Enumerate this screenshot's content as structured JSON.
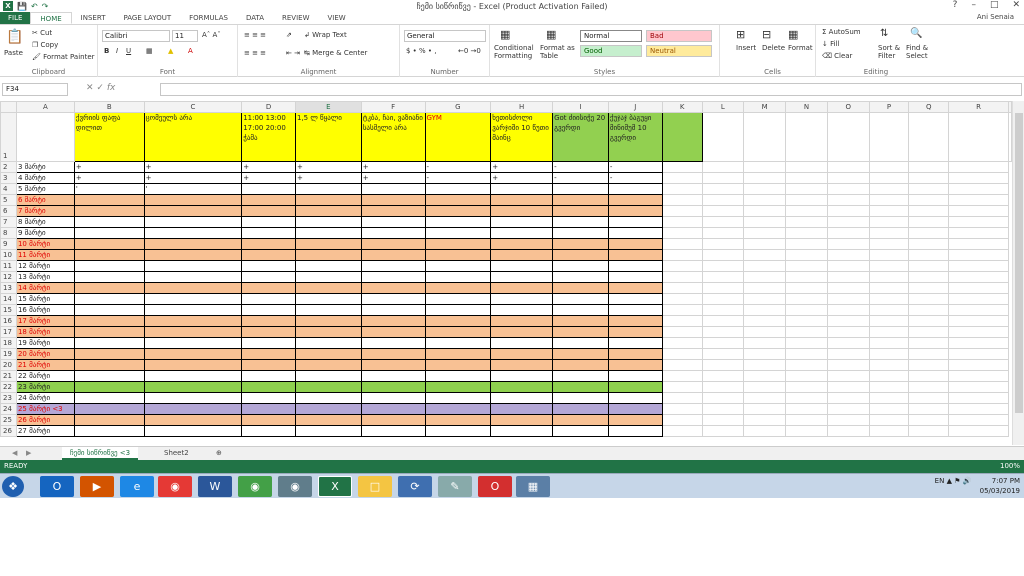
{
  "window": {
    "title": "ჩემი სიწრიწვე - Excel (Product Activation Failed)",
    "user": "Ani Senaia"
  },
  "tabs": [
    "FILE",
    "HOME",
    "INSERT",
    "PAGE LAYOUT",
    "FORMULAS",
    "DATA",
    "REVIEW",
    "VIEW"
  ],
  "ribbon": {
    "clipboard": {
      "paste": "Paste",
      "cut": "Cut",
      "copy": "Copy",
      "format_painter": "Format Painter",
      "label": "Clipboard"
    },
    "font": {
      "name": "Calibri",
      "size": "11",
      "label": "Font"
    },
    "alignment": {
      "wrap": "Wrap Text",
      "merge": "Merge & Center",
      "label": "Alignment"
    },
    "number": {
      "format": "General",
      "label": "Number"
    },
    "styles": {
      "conditional": "Conditional Formatting",
      "format_table": "Format as Table",
      "normal": "Normal",
      "bad": "Bad",
      "good": "Good",
      "neutral": "Neutral",
      "label": "Styles"
    },
    "cells": {
      "insert": "Insert",
      "delete": "Delete",
      "format": "Format",
      "label": "Cells"
    },
    "editing": {
      "autosum": "AutoSum",
      "fill": "Fill",
      "clear": "Clear",
      "sort": "Sort & Filter",
      "find": "Find & Select",
      "label": "Editing"
    }
  },
  "formula_bar": {
    "name_box": "F34",
    "formula": ""
  },
  "columns": [
    "A",
    "B",
    "C",
    "D",
    "E",
    "F",
    "G",
    "H",
    "I",
    "J",
    "K",
    "L",
    "M",
    "N",
    "O",
    "P",
    "Q",
    "R"
  ],
  "header_row": {
    "row_num": "1",
    "cells": [
      "",
      "ქვრიის ფაფა დილით",
      "ცომეულს არა",
      "11:00 13:00 17:00 20:00 ჭამა",
      "1,5 ლ წყალი",
      "ტკბა, ჩაი, ვაზიანი სასმელი არა",
      "GYM",
      "ხეთისძოლი ვარჯიში 10 წუთი მაინც",
      "Got ძიისიჭე 20 გვერდი",
      "ქუჯაჯ ბაგუყი მინიმუმ 10 გვერდი",
      ""
    ]
  },
  "rows": [
    {
      "n": "2",
      "a": "3 მარტი",
      "fill": "",
      "red": false,
      "marks": [
        "+",
        "+",
        "+",
        "+",
        "+",
        "-",
        "+",
        "-",
        "-"
      ]
    },
    {
      "n": "3",
      "a": "4 მარტი",
      "fill": "",
      "red": false,
      "marks": [
        "+",
        "+",
        "+",
        "+",
        "+",
        "-",
        "+",
        "-",
        "-"
      ]
    },
    {
      "n": "4",
      "a": "5 მარტი",
      "fill": "",
      "red": false,
      "marks": [
        "'",
        "'",
        "",
        "",
        "",
        "",
        "",
        "",
        ""
      ]
    },
    {
      "n": "5",
      "a": "6 მარტი",
      "fill": "o",
      "red": true,
      "marks": []
    },
    {
      "n": "6",
      "a": "7 მარტი",
      "fill": "o",
      "red": true,
      "marks": []
    },
    {
      "n": "7",
      "a": "8 მარტი",
      "fill": "",
      "red": false,
      "marks": []
    },
    {
      "n": "8",
      "a": "9 მარტი",
      "fill": "",
      "red": false,
      "marks": []
    },
    {
      "n": "9",
      "a": "10 მარტი",
      "fill": "o",
      "red": true,
      "marks": []
    },
    {
      "n": "10",
      "a": "11 მარტი",
      "fill": "o",
      "red": true,
      "marks": []
    },
    {
      "n": "11",
      "a": "12 მარტი",
      "fill": "",
      "red": false,
      "marks": []
    },
    {
      "n": "12",
      "a": "13 მარტი",
      "fill": "",
      "red": false,
      "marks": []
    },
    {
      "n": "13",
      "a": "14 მარტი",
      "fill": "o",
      "red": true,
      "marks": []
    },
    {
      "n": "14",
      "a": "15 მარტი",
      "fill": "",
      "red": false,
      "marks": []
    },
    {
      "n": "15",
      "a": "16 მარტი",
      "fill": "",
      "red": false,
      "marks": []
    },
    {
      "n": "16",
      "a": "17 მარტი",
      "fill": "o",
      "red": true,
      "marks": []
    },
    {
      "n": "17",
      "a": "18 მარტი",
      "fill": "o",
      "red": true,
      "marks": []
    },
    {
      "n": "18",
      "a": "19 მარტი",
      "fill": "",
      "red": false,
      "marks": []
    },
    {
      "n": "19",
      "a": "20 მარტი",
      "fill": "o",
      "red": true,
      "marks": []
    },
    {
      "n": "20",
      "a": "21 მარტი",
      "fill": "o",
      "red": true,
      "marks": []
    },
    {
      "n": "21",
      "a": "22 მარტი",
      "fill": "",
      "red": false,
      "marks": []
    },
    {
      "n": "22",
      "a": "23 მარტი",
      "fill": "gr",
      "red": false,
      "marks": []
    },
    {
      "n": "23",
      "a": "24 მარტი",
      "fill": "",
      "red": false,
      "marks": []
    },
    {
      "n": "24",
      "a": "25 მარტი <3",
      "fill": "pu",
      "red": true,
      "marks": []
    },
    {
      "n": "25",
      "a": "26 მარტი",
      "fill": "o",
      "red": true,
      "marks": []
    },
    {
      "n": "26",
      "a": "27 მარტი",
      "fill": "",
      "red": false,
      "marks": []
    }
  ],
  "sheets": [
    "ჩემი სიწრიწვე <3",
    "Sheet2"
  ],
  "status": {
    "ready": "READY",
    "zoom": "100%"
  },
  "tray": {
    "lang": "EN",
    "time": "7:07 PM",
    "date": "05/03/2019"
  },
  "colors": {
    "excel_green": "#217346",
    "yellow": "#ffff00",
    "green": "#92d050",
    "orange": "#f8c194",
    "purple": "#b4a7d6"
  }
}
